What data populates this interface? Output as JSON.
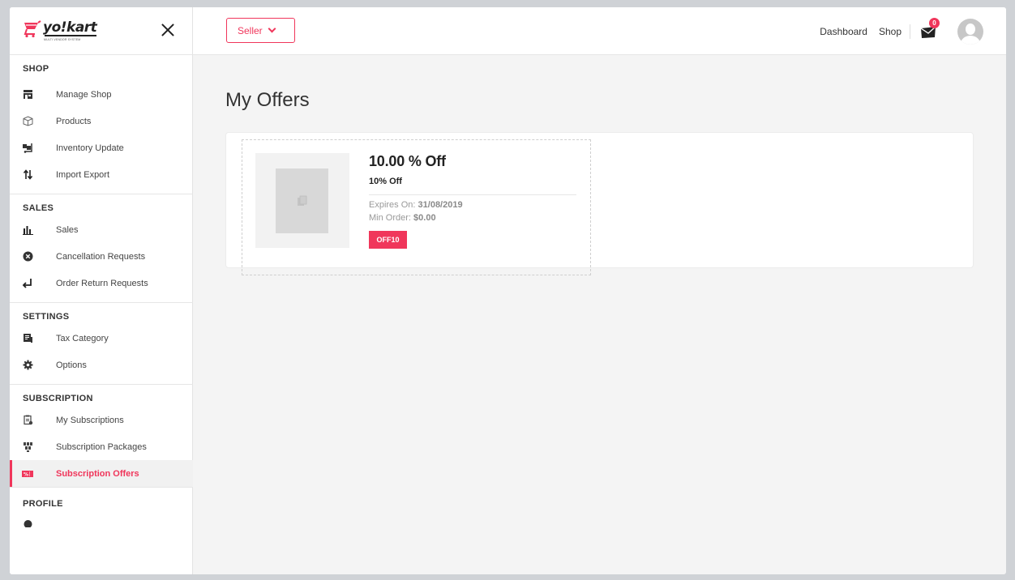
{
  "brand": {
    "name": "yo!kart",
    "tagline": "MULTI VENDOR SYSTEM",
    "accent_color": "#f0365b"
  },
  "header": {
    "role_selector": "Seller",
    "links": [
      "Dashboard",
      "Shop"
    ],
    "notifications_count": "0"
  },
  "sidebar": {
    "sections": [
      {
        "title": "SHOP",
        "items": [
          {
            "label": "Manage Shop",
            "icon": "store-icon"
          },
          {
            "label": "Products",
            "icon": "box-icon"
          },
          {
            "label": "Inventory Update",
            "icon": "dolly-icon"
          },
          {
            "label": "Import Export",
            "icon": "sort-arrows-icon"
          }
        ]
      },
      {
        "title": "SALES",
        "items": [
          {
            "label": "Sales",
            "icon": "bar-chart-icon"
          },
          {
            "label": "Cancellation Requests",
            "icon": "times-circle-icon"
          },
          {
            "label": "Order Return Requests",
            "icon": "return-arrow-icon"
          }
        ]
      },
      {
        "title": "SETTINGS",
        "items": [
          {
            "label": "Tax Category",
            "icon": "receipt-icon"
          },
          {
            "label": "Options",
            "icon": "gear-icon"
          }
        ]
      },
      {
        "title": "SUBSCRIPTION",
        "items": [
          {
            "label": "My Subscriptions",
            "icon": "clipboard-icon"
          },
          {
            "label": "Subscription Packages",
            "icon": "packages-icon"
          },
          {
            "label": "Subscription Offers",
            "icon": "percent-tag-icon",
            "active": true
          }
        ]
      },
      {
        "title": "PROFILE",
        "items": []
      }
    ]
  },
  "main": {
    "title": "My Offers",
    "offers": [
      {
        "title": "10.00 % Off",
        "subtitle": "10% Off",
        "expires_label": "Expires On:",
        "expires_value": "31/08/2019",
        "min_order_label": "Min Order:",
        "min_order_value": "$0.00",
        "code": "OFF10"
      }
    ]
  }
}
